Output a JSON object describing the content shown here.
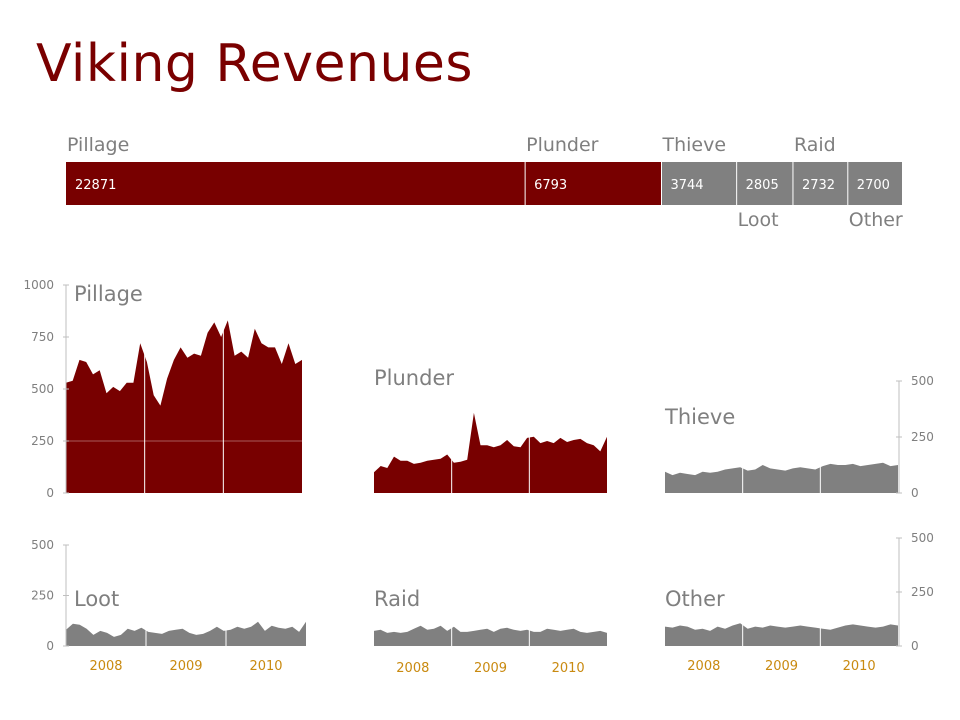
{
  "title": "Viking Revenues",
  "colors": {
    "primary": "#780000",
    "secondary": "#808080",
    "title": "#7a0000",
    "label": "#7f7f7f",
    "year": "#c98a10"
  },
  "chart_data": [
    {
      "type": "bar",
      "orientation": "stacked-horizontal",
      "categories": [
        "Pillage",
        "Plunder",
        "Thieve",
        "Loot",
        "Raid",
        "Other"
      ],
      "values": [
        22871,
        6793,
        3744,
        2805,
        2732,
        2700
      ],
      "highlight": [
        "Pillage",
        "Plunder"
      ]
    },
    {
      "type": "area",
      "title": "Pillage",
      "ylim": [
        0,
        1000
      ],
      "yticks": [
        0,
        250,
        500,
        750,
        1000
      ],
      "years": [
        "2008",
        "2009",
        "2010"
      ],
      "values": [
        530,
        540,
        640,
        630,
        570,
        590,
        480,
        510,
        490,
        530,
        530,
        720,
        630,
        470,
        420,
        550,
        640,
        700,
        650,
        670,
        660,
        770,
        820,
        750,
        830,
        660,
        680,
        650,
        790,
        720,
        700,
        700,
        620,
        720,
        620,
        640
      ]
    },
    {
      "type": "area",
      "title": "Plunder",
      "ylim": [
        0,
        500
      ],
      "yticks": [],
      "years": [
        "2008",
        "2009",
        "2010"
      ],
      "values": [
        100,
        130,
        120,
        175,
        155,
        155,
        140,
        145,
        155,
        160,
        165,
        185,
        145,
        150,
        160,
        385,
        230,
        230,
        220,
        230,
        255,
        225,
        220,
        265,
        270,
        240,
        250,
        240,
        265,
        245,
        255,
        260,
        240,
        230,
        200,
        270
      ]
    },
    {
      "type": "area",
      "title": "Thieve",
      "ylim": [
        0,
        500
      ],
      "yticks": [
        0,
        250,
        500
      ],
      "years": [
        "2008",
        "2009",
        "2010"
      ],
      "values": [
        95,
        80,
        90,
        85,
        80,
        95,
        90,
        95,
        105,
        110,
        115,
        100,
        105,
        125,
        110,
        105,
        100,
        110,
        115,
        110,
        105,
        120,
        130,
        125,
        125,
        130,
        120,
        125,
        130,
        135,
        120,
        125
      ]
    },
    {
      "type": "area",
      "title": "Loot",
      "ylim": [
        0,
        500
      ],
      "yticks": [
        0,
        250,
        500
      ],
      "years": [
        "2008",
        "2009",
        "2010"
      ],
      "values": [
        80,
        110,
        105,
        85,
        55,
        75,
        65,
        45,
        55,
        85,
        75,
        90,
        70,
        65,
        60,
        75,
        80,
        85,
        65,
        55,
        60,
        75,
        95,
        75,
        80,
        95,
        85,
        95,
        120,
        75,
        100,
        90,
        85,
        95,
        70,
        120
      ]
    },
    {
      "type": "area",
      "title": "Raid",
      "ylim": [
        0,
        500
      ],
      "yticks": [],
      "years": [
        "2008",
        "2009",
        "2010"
      ],
      "values": [
        75,
        80,
        65,
        70,
        65,
        70,
        85,
        100,
        80,
        85,
        100,
        75,
        95,
        70,
        70,
        75,
        80,
        85,
        70,
        85,
        90,
        80,
        75,
        80,
        70,
        70,
        85,
        80,
        75,
        80,
        85,
        70,
        65,
        70,
        75,
        65
      ]
    },
    {
      "type": "area",
      "title": "Other",
      "ylim": [
        0,
        500
      ],
      "yticks": [
        0,
        250,
        500
      ],
      "years": [
        "2008",
        "2009",
        "2010"
      ],
      "values": [
        90,
        85,
        95,
        90,
        75,
        80,
        70,
        90,
        80,
        95,
        105,
        80,
        90,
        85,
        95,
        90,
        85,
        90,
        95,
        90,
        85,
        80,
        75,
        85,
        95,
        100,
        95,
        90,
        85,
        90,
        100,
        95
      ]
    }
  ]
}
